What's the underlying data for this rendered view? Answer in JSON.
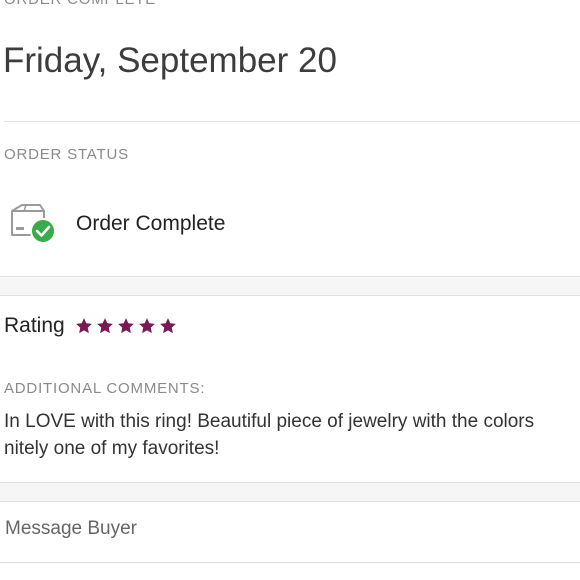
{
  "header": {
    "section_label": "ORDER COMPLETE",
    "date": "Friday, September 20"
  },
  "order_status": {
    "label": "ORDER STATUS",
    "status_text": "Order Complete",
    "icon": "box-check-icon",
    "check_color": "#3aab4a"
  },
  "rating": {
    "label": "Rating",
    "stars": 5,
    "max_stars": 5,
    "star_color": "#7a1a52"
  },
  "comments": {
    "label": "ADDITIONAL COMMENTS:",
    "line1": "In LOVE with this ring! Beautiful piece of jewelry with the colors",
    "line2": "nitely one of my favorites!"
  },
  "actions": {
    "message_buyer": "Message Buyer"
  }
}
